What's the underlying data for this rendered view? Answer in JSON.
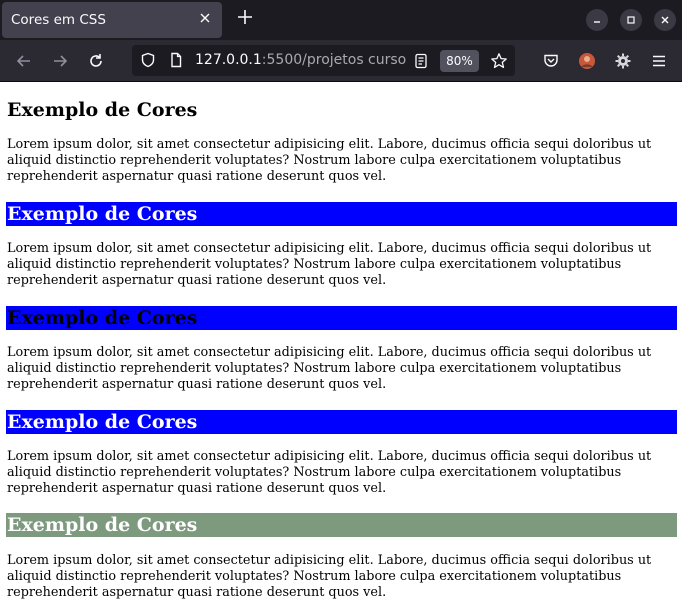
{
  "browser": {
    "tab_title": "Cores em CSS",
    "tab_close_icon": "close-icon",
    "new_tab_icon": "plus-icon",
    "url_host": "127.0.0.1",
    "url_rest": ":5500/projetos curso",
    "zoom": "80%",
    "window_controls": [
      "minimize-icon",
      "maximize-icon",
      "close-icon"
    ],
    "toolbar_icons": [
      "back-arrow-icon",
      "forward-arrow-icon",
      "reload-icon",
      "shield-icon",
      "page-icon",
      "reader-view-icon",
      "bookmark-star-icon",
      "pocket-icon",
      "avatar",
      "extension-gear-icon",
      "menu-icon"
    ]
  },
  "page": {
    "sections": [
      {
        "heading": "Exemplo de Cores",
        "heading_bg": "transparent",
        "heading_color": "#000000",
        "paragraph": "Lorem ipsum dolor, sit amet consectetur adipisicing elit. Labore, ducimus officia sequi doloribus ut aliquid distinctio reprehenderit voluptates? Nostrum labore culpa exercitationem voluptatibus reprehenderit aspernatur quasi ratione deserunt quos vel."
      },
      {
        "heading": "Exemplo de Cores",
        "heading_bg": "#0000ff",
        "heading_color": "#ffffff",
        "paragraph": "Lorem ipsum dolor, sit amet consectetur adipisicing elit. Labore, ducimus officia sequi doloribus ut aliquid distinctio reprehenderit voluptates? Nostrum labore culpa exercitationem voluptatibus reprehenderit aspernatur quasi ratione deserunt quos vel."
      },
      {
        "heading": "Exemplo de Cores",
        "heading_bg": "#0000ff",
        "heading_color": "#000000",
        "paragraph": "Lorem ipsum dolor, sit amet consectetur adipisicing elit. Labore, ducimus officia sequi doloribus ut aliquid distinctio reprehenderit voluptates? Nostrum labore culpa exercitationem voluptatibus reprehenderit aspernatur quasi ratione deserunt quos vel."
      },
      {
        "heading": "Exemplo de Cores",
        "heading_bg": "#0000ff",
        "heading_color": "#ffffff",
        "paragraph": "Lorem ipsum dolor, sit amet consectetur adipisicing elit. Labore, ducimus officia sequi doloribus ut aliquid distinctio reprehenderit voluptates? Nostrum labore culpa exercitationem voluptatibus reprehenderit aspernatur quasi ratione deserunt quos vel."
      },
      {
        "heading": "Exemplo de Cores",
        "heading_bg": "#7d9a7f",
        "heading_color": "#ffffff",
        "paragraph": "Lorem ipsum dolor, sit amet consectetur adipisicing elit. Labore, ducimus officia sequi doloribus ut aliquid distinctio reprehenderit voluptates? Nostrum labore culpa exercitationem voluptatibus reprehenderit aspernatur quasi ratione deserunt quos vel."
      }
    ]
  }
}
